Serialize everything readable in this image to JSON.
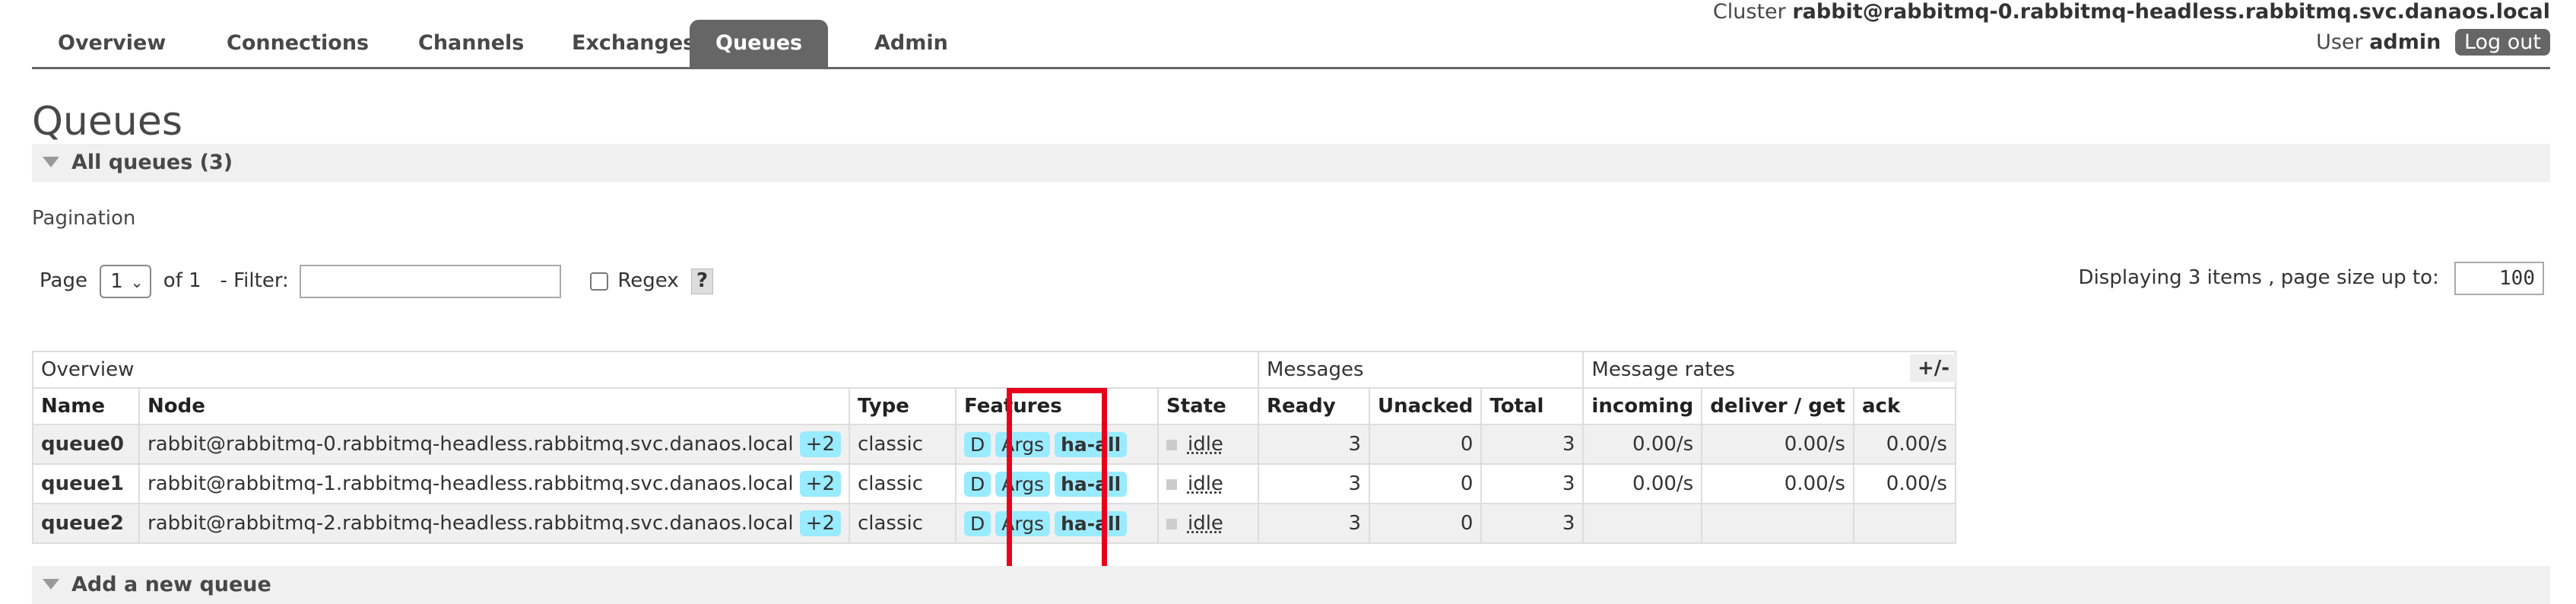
{
  "nav": {
    "tabs": [
      "Overview",
      "Connections",
      "Channels",
      "Exchanges",
      "Queues",
      "Admin"
    ],
    "active": "Queues"
  },
  "cluster": {
    "label": "Cluster",
    "value": "rabbit@rabbitmq-0.rabbitmq-headless.rabbitmq.svc.danaos.local"
  },
  "user": {
    "label": "User",
    "value": "admin",
    "logout": "Log out"
  },
  "page_title": "Queues",
  "all_queues": "All queues (3)",
  "pagination": {
    "title": "Pagination",
    "page_label": "Page",
    "page_value": "1",
    "of_label": "of 1",
    "filter_label": "- Filter:",
    "filter_value": "",
    "regex_label": "Regex",
    "help": "?",
    "displaying": "Displaying 3 items , page size up to:",
    "page_size": "100"
  },
  "table": {
    "groups": {
      "overview": "Overview",
      "messages": "Messages",
      "rates": "Message rates"
    },
    "columns": [
      "Name",
      "Node",
      "Type",
      "Features",
      "State",
      "Ready",
      "Unacked",
      "Total",
      "incoming",
      "deliver / get",
      "ack"
    ],
    "rows": [
      {
        "name": "queue0",
        "node": "rabbit@rabbitmq-0.rabbitmq-headless.rabbitmq.svc.danaos.local",
        "node_more": "+2",
        "type": "classic",
        "feat_d": "D",
        "feat_args": "Args",
        "policy": "ha-all",
        "state": "idle",
        "ready": "3",
        "unacked": "0",
        "total": "3",
        "incoming": "0.00/s",
        "deliver": "0.00/s",
        "ack": "0.00/s"
      },
      {
        "name": "queue1",
        "node": "rabbit@rabbitmq-1.rabbitmq-headless.rabbitmq.svc.danaos.local",
        "node_more": "+2",
        "type": "classic",
        "feat_d": "D",
        "feat_args": "Args",
        "policy": "ha-all",
        "state": "idle",
        "ready": "3",
        "unacked": "0",
        "total": "3",
        "incoming": "0.00/s",
        "deliver": "0.00/s",
        "ack": "0.00/s"
      },
      {
        "name": "queue2",
        "node": "rabbit@rabbitmq-2.rabbitmq-headless.rabbitmq.svc.danaos.local",
        "node_more": "+2",
        "type": "classic",
        "feat_d": "D",
        "feat_args": "Args",
        "policy": "ha-all",
        "state": "idle",
        "ready": "3",
        "unacked": "0",
        "total": "3",
        "incoming": "",
        "deliver": "",
        "ack": ""
      }
    ],
    "columns_toggle": "+/-"
  },
  "add_queue": "Add a new queue",
  "colors": {
    "highlight": "#e8001c",
    "badge": "#99ebff",
    "nav_active": "#666666"
  }
}
